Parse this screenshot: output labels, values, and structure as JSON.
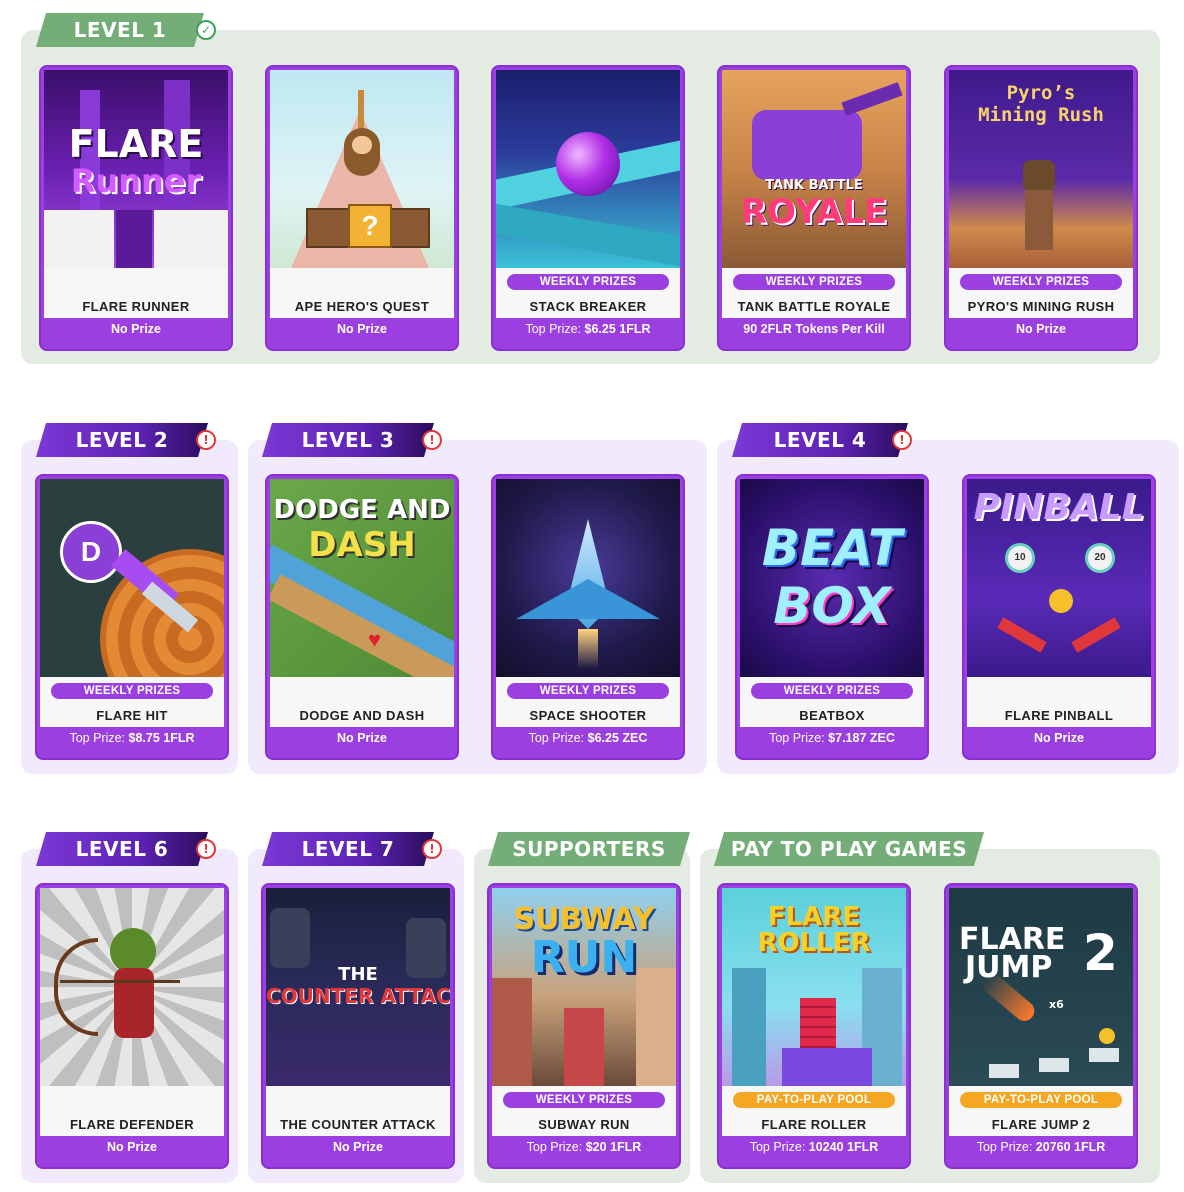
{
  "sections": {
    "level1": {
      "label": "LEVEL 1",
      "status": "✓"
    },
    "level2": {
      "label": "LEVEL 2",
      "status": "!"
    },
    "level3": {
      "label": "LEVEL 3",
      "status": "!"
    },
    "level4": {
      "label": "LEVEL 4",
      "status": "!"
    },
    "level6": {
      "label": "LEVEL 6",
      "status": "!"
    },
    "level7": {
      "label": "LEVEL 7",
      "status": "!"
    },
    "supporters": {
      "label": "SUPPORTERS"
    },
    "pay": {
      "label": "PAY TO PLAY GAMES"
    }
  },
  "colors": {
    "green_panel": "#e3ebe3",
    "purple_panel": "#f0eafc",
    "card_purple": "#9c3fe0",
    "pill_orange": "#f5a623",
    "tag_green": "#74ad77"
  },
  "games": {
    "flare_runner": {
      "name": "FLARE RUNNER",
      "prize": "No Prize",
      "art": [
        "FLARE",
        "Runner"
      ]
    },
    "ape_hero": {
      "name": "APE HERO'S QUEST",
      "prize": "No Prize"
    },
    "stack_breaker": {
      "badge": "WEEKLY PRIZES",
      "name": "STACK BREAKER",
      "prize_label": "Top Prize:",
      "prize_value": "$6.25 1FLR"
    },
    "tank_battle": {
      "badge": "WEEKLY PRIZES",
      "name": "TANK BATTLE ROYALE",
      "prize": "90 2FLR Tokens Per Kill",
      "art": [
        "TANK BATTLE",
        "ROYALE"
      ]
    },
    "pyro": {
      "badge": "WEEKLY PRIZES",
      "name": "PYRO'S MINING RUSH",
      "prize": "No Prize",
      "art": [
        "Pyro’s",
        "Mining Rush"
      ]
    },
    "flare_hit": {
      "badge": "WEEKLY PRIZES",
      "name": "FLARE HIT",
      "prize_label": "Top Prize:",
      "prize_value": "$8.75 1FLR"
    },
    "dodge_dash": {
      "name": "DODGE AND DASH",
      "prize": "No Prize",
      "art": [
        "DODGE AND",
        "DASH"
      ]
    },
    "space_shooter": {
      "badge": "WEEKLY PRIZES",
      "name": "SPACE SHOOTER",
      "prize_label": "Top Prize:",
      "prize_value": "$6.25 ZEC"
    },
    "beatbox": {
      "badge": "WEEKLY PRIZES",
      "name": "BEATBOX",
      "prize_label": "Top Prize:",
      "prize_value": "$7.187 ZEC",
      "art": [
        "BEAT",
        "BOX"
      ]
    },
    "pinball": {
      "name": "FLARE PINBALL",
      "prize": "No Prize",
      "art": [
        "PINBALL",
        "10",
        "20"
      ]
    },
    "defender": {
      "name": "FLARE DEFENDER",
      "prize": "No Prize"
    },
    "counter": {
      "name": "THE COUNTER ATTACK",
      "prize": "No Prize",
      "art": [
        "THE",
        "COUNTER ATTACK"
      ]
    },
    "subway": {
      "badge": "WEEKLY PRIZES",
      "name": "SUBWAY RUN",
      "prize_label": "Top Prize:",
      "prize_value": "$20 1FLR",
      "art": [
        "SUBWAY",
        "RUN"
      ]
    },
    "roller": {
      "badge": "PAY-TO-PLAY POOL",
      "name": "FLARE ROLLER",
      "prize_label": "Top Prize:",
      "prize_value": "10240 1FLR",
      "art": [
        "FLARE",
        "ROLLER"
      ]
    },
    "jump2": {
      "badge": "PAY-TO-PLAY POOL",
      "name": "FLARE JUMP 2",
      "prize_label": "Top Prize:",
      "prize_value": "20760 1FLR",
      "art": [
        "FLARE",
        "JUMP",
        "2",
        "x6"
      ]
    }
  }
}
